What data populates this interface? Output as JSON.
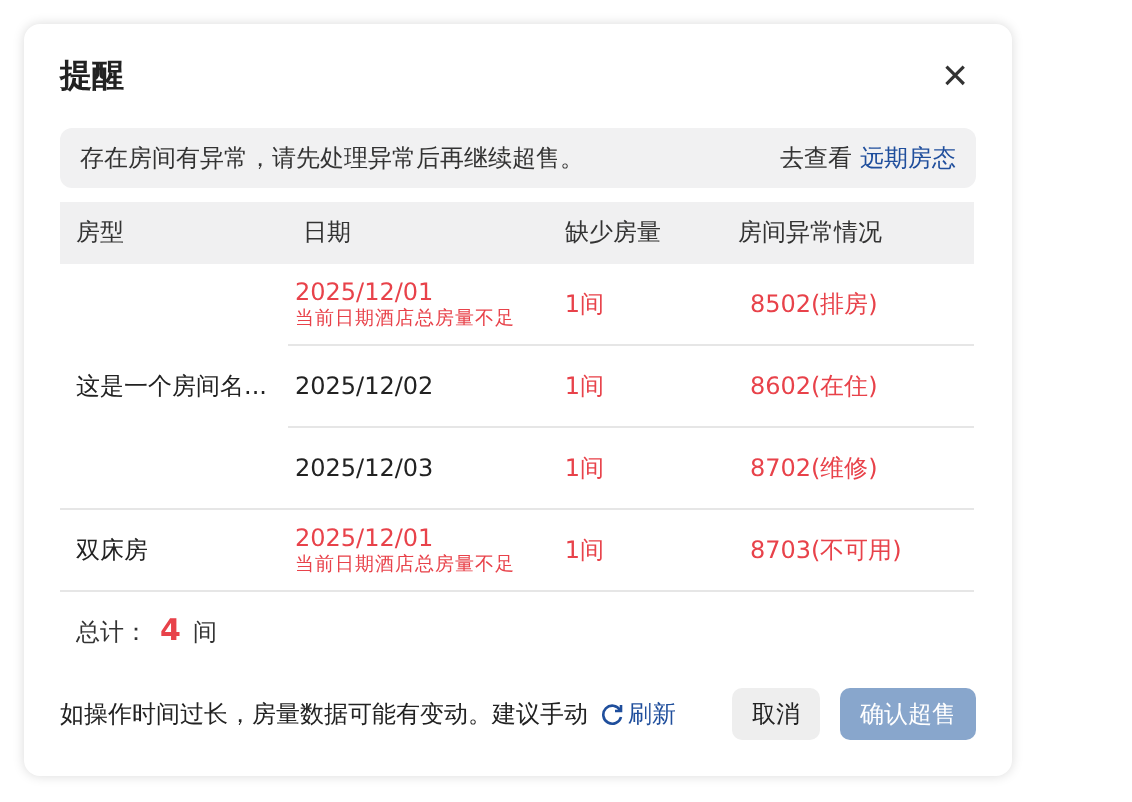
{
  "dialog": {
    "title": "提醒",
    "close": "×"
  },
  "alert": {
    "message": "存在房间有异常，请先处理异常后再继续超售。",
    "link_prefix": "去查看",
    "link": "远期房态"
  },
  "table": {
    "columns": [
      "房型",
      "日期",
      "缺少房量",
      "房间异常情况"
    ],
    "groups": [
      {
        "room_type": "这是一个房间名...",
        "dates": [
          {
            "date": "2025/12/01",
            "flagged": true,
            "note": "当前日期酒店总房量不足",
            "shortage": "1间",
            "exception": "8502(排房)"
          },
          {
            "date": "2025/12/02",
            "flagged": false,
            "shortage": "1间",
            "exception": "8602(在住)"
          },
          {
            "date": "2025/12/03",
            "flagged": false,
            "shortage": "1间",
            "exception": "8702(维修)"
          }
        ]
      },
      {
        "room_type": "双床房",
        "dates": [
          {
            "date": "2025/12/01",
            "flagged": true,
            "note": "当前日期酒店总房量不足",
            "shortage": "1间",
            "exception": "8703(不可用)"
          }
        ]
      }
    ]
  },
  "total": {
    "label": "总计：",
    "count": "4",
    "unit": "间"
  },
  "footer": {
    "hint": "如操作时间过长，房量数据可能有变动。建议手动",
    "refresh": "刷新",
    "buttons": [
      {
        "label": "取消",
        "kind": "secondary",
        "disabled": false
      },
      {
        "label": "确认超售",
        "kind": "primary",
        "disabled": true
      }
    ]
  }
}
